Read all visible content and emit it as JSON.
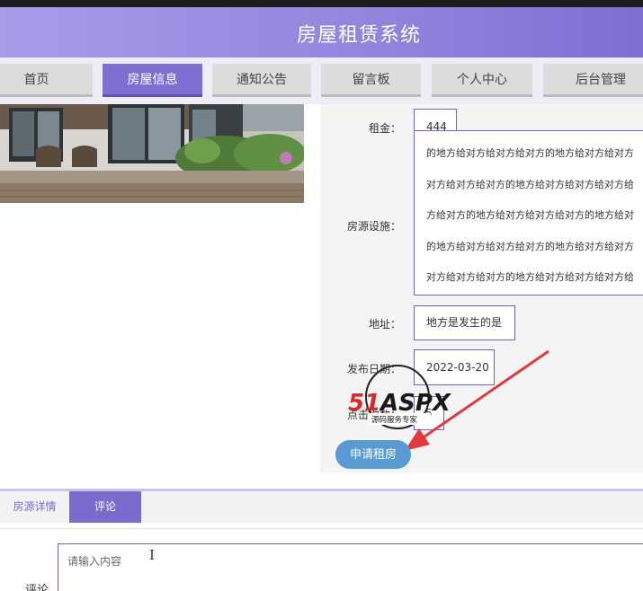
{
  "header": {
    "title": "房屋租赁系统"
  },
  "nav": {
    "items": [
      {
        "label": "首页"
      },
      {
        "label": "房屋信息"
      },
      {
        "label": "通知公告"
      },
      {
        "label": "留言板"
      },
      {
        "label": "个人中心"
      },
      {
        "label": "后台管理"
      }
    ],
    "active_index": 1
  },
  "detail": {
    "rent_label": "租金：",
    "rent_value": "444",
    "facility_label": "房源设施：",
    "facility_lines": [
      "的地方给对方给对方给对方的地方给对方给对方",
      "对方给对方给对方的地方给对方给对方给对方给",
      "方给对方的地方给对方给对方给对方的地方给对",
      "的地方给对方给对方给对方的地方给对方给对方",
      "对方给对方给对方的地方给对方给对方给对方给"
    ],
    "address_label": "地址：",
    "address_value": "地方是发生的是",
    "date_label": "发布日期：",
    "date_value": "2022-03-20",
    "clicks_label": "点击次数：",
    "clicks_value": "5",
    "apply_button": "申请租房"
  },
  "watermark": {
    "brand": "51ASPX",
    "subtitle": "源码服务专家"
  },
  "tabs": [
    {
      "label": "房源详情"
    },
    {
      "label": "评论"
    }
  ],
  "active_tab": 1,
  "comment": {
    "label": "评论",
    "placeholder": "请输入内容"
  },
  "colors": {
    "header_gradient_start": "#a99ae9",
    "header_gradient_end": "#7d6fd2",
    "nav_active": "#7f6fd3",
    "nav_inactive": "#dcdcdc",
    "button_blue": "#5a9ad3",
    "arrow_red": "#e0393e",
    "field_border": "#6d62c6"
  }
}
